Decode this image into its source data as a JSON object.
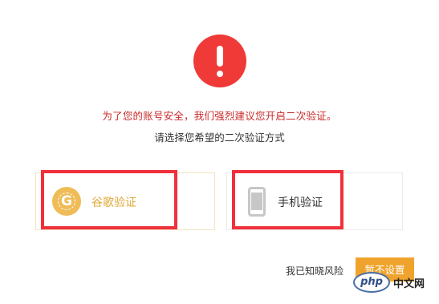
{
  "alert": {
    "icon": "exclamation-circle-icon",
    "color": "#ef3a38"
  },
  "message": {
    "warning": "为了您的账号安全，我们强烈建议您开启二次验证。",
    "subtitle": "请选择您希望的二次验证方式"
  },
  "options": [
    {
      "label": "谷歌验证",
      "icon": "google-authenticator-icon",
      "accent": "#e0a83a"
    },
    {
      "label": "手机验证",
      "icon": "mobile-phone-icon",
      "accent": "#333333"
    }
  ],
  "actions": {
    "acknowledge": "我已知晓风险",
    "setup": "暂不设置"
  },
  "watermark": {
    "logo": "php",
    "text": "中文网"
  }
}
